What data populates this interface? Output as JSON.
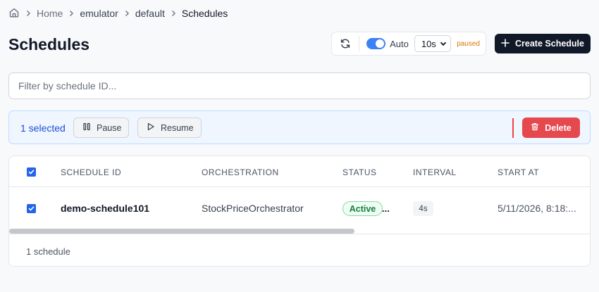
{
  "breadcrumb": {
    "items": [
      "Home",
      "emulator",
      "default",
      "Schedules"
    ]
  },
  "page": {
    "title": "Schedules"
  },
  "toolbar": {
    "auto_label": "Auto",
    "interval_value": "10s",
    "paused_label": "paused",
    "create_label": "Create Schedule"
  },
  "filter": {
    "placeholder": "Filter by schedule ID..."
  },
  "selection": {
    "count_label": "1 selected",
    "pause_label": "Pause",
    "resume_label": "Resume",
    "delete_label": "Delete"
  },
  "table": {
    "columns": [
      "SCHEDULE ID",
      "ORCHESTRATION",
      "STATUS",
      "INTERVAL",
      "START AT"
    ],
    "rows": [
      {
        "schedule_id": "demo-schedule101",
        "orchestration": "StockPriceOrchestrator",
        "status": "Active",
        "status_overflow": "...",
        "interval": "4s",
        "start_at": "5/11/2026, 8:18:..."
      }
    ],
    "footer": "1 schedule"
  },
  "colors": {
    "accent": "#3b82f6",
    "primary_button": "#111827",
    "danger": "#e5484d",
    "paused": "#d97706",
    "active_status": "#15803d"
  }
}
